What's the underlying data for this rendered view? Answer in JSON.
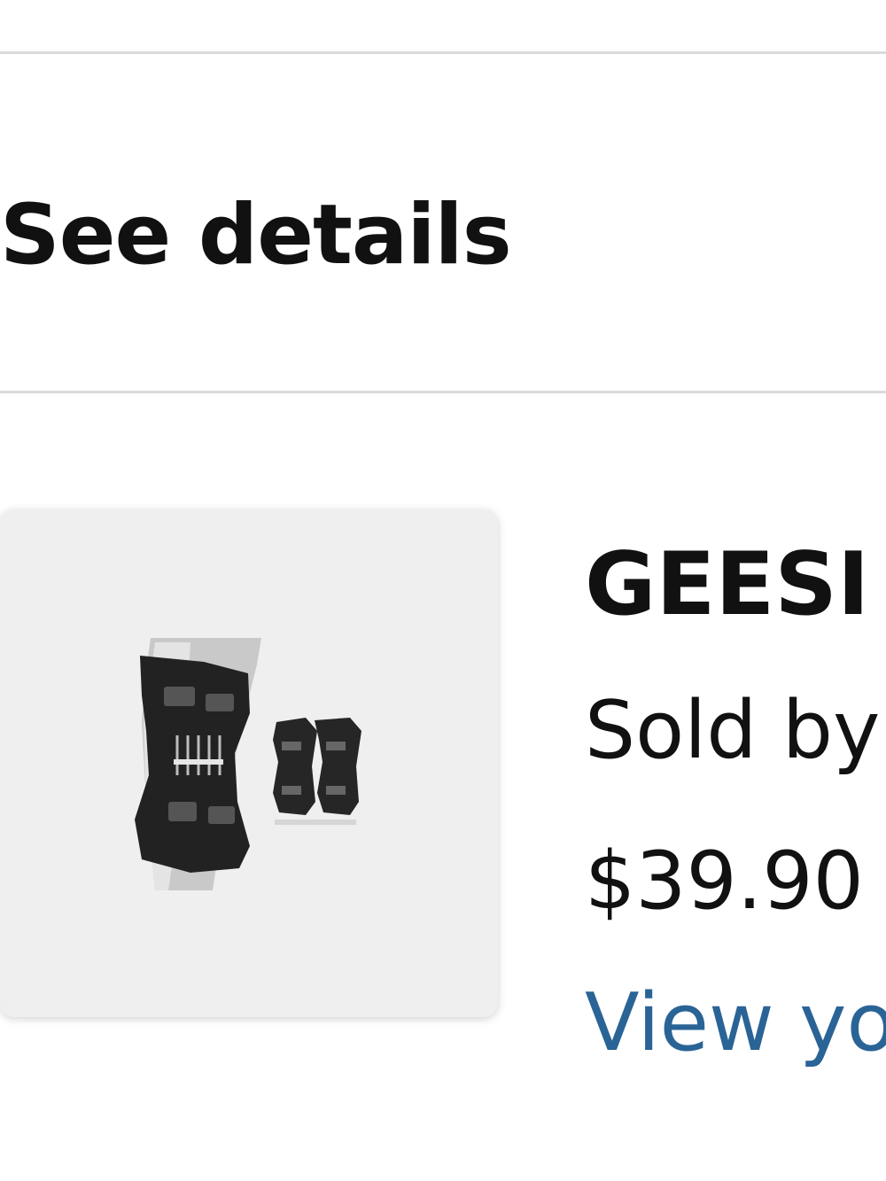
{
  "section": {
    "see_details_label": "See details"
  },
  "order_item": {
    "image_icon": "knee-brace-product-image",
    "product_name": "GEESI",
    "sold_by": "Sold by",
    "price": "$39.90",
    "view_link": "View yo"
  },
  "colors": {
    "link": "#2a6496",
    "divider": "#d9dadb",
    "thumb_bg": "#efefef"
  }
}
